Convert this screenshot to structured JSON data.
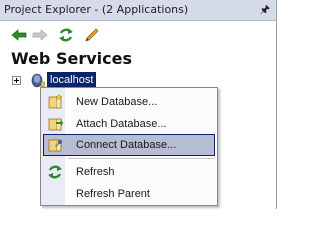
{
  "panel": {
    "title": "Project Explorer - (2 Applications)",
    "pin_icon": "pin-icon"
  },
  "toolbar": {
    "icons": [
      "back-arrow-icon",
      "forward-arrow-icon",
      "refresh-icon",
      "pencil-icon"
    ]
  },
  "heading": "Web Services",
  "tree": {
    "node_label": "localhost",
    "node_icon": "server-icon",
    "expanded": false
  },
  "context_menu": {
    "items": [
      {
        "label": "New Database...",
        "icon": "new-database-icon"
      },
      {
        "label": "Attach Database...",
        "icon": "attach-database-icon"
      },
      {
        "label": "Connect Database...",
        "icon": "connect-database-icon",
        "highlighted": true
      },
      {
        "label": "Refresh",
        "icon": "refresh-icon"
      },
      {
        "label": "Refresh Parent",
        "icon": ""
      }
    ]
  },
  "colors": {
    "selection": "#0a246a",
    "menu_highlight": "#b6bdd2",
    "title_bar": "#d6dbe9"
  }
}
